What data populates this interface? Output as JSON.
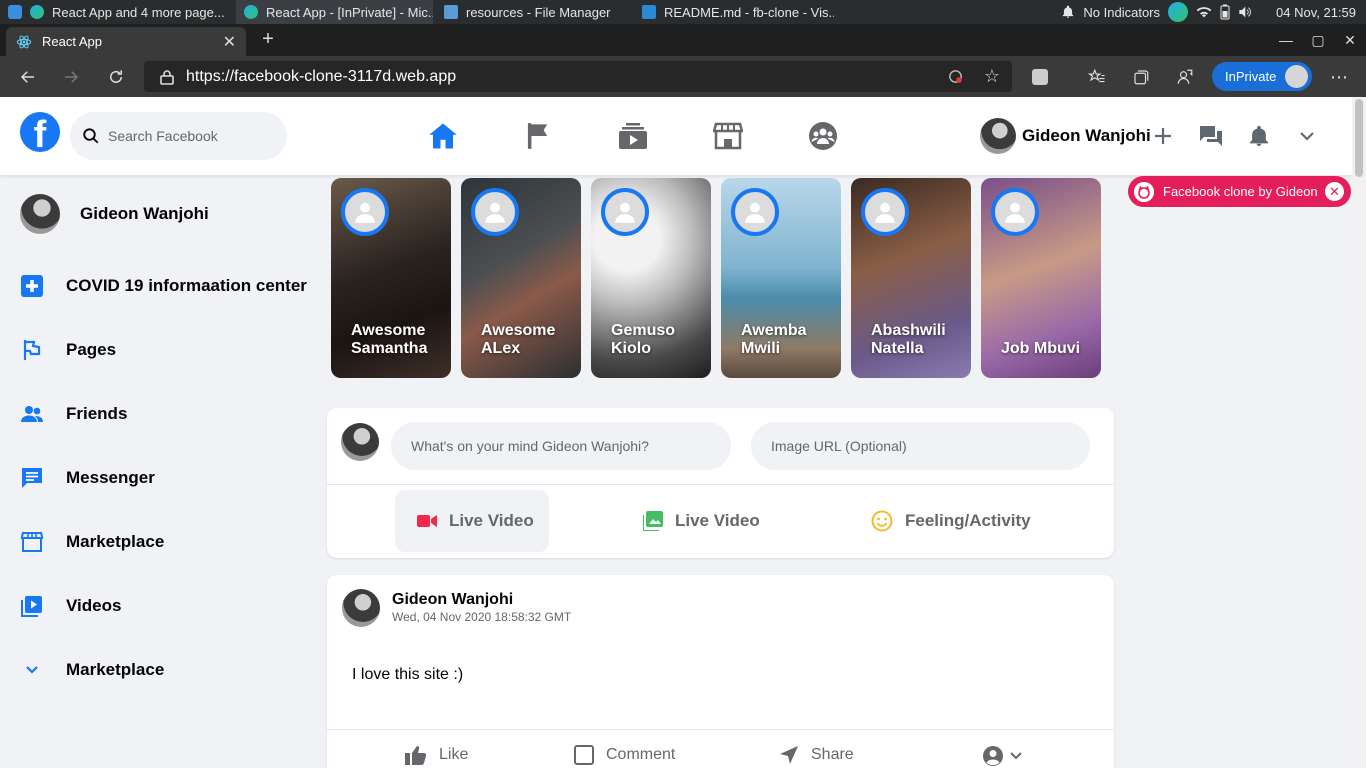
{
  "taskbar": {
    "tasks": [
      {
        "label": "React App and 4 more page..."
      },
      {
        "label": "React App - [InPrivate] - Mic..."
      },
      {
        "label": "resources - File Manager"
      },
      {
        "label": "README.md - fb-clone - Vis..."
      }
    ],
    "indicator_text": "No Indicators",
    "datetime": "04 Nov, 21:59"
  },
  "browser": {
    "tab_title": "React App",
    "url": "https://facebook-clone-3117d.web.app",
    "inprivate_label": "InPrivate"
  },
  "header": {
    "search_placeholder": "Search Facebook",
    "user_name": "Gideon Wanjohi"
  },
  "sidebar": {
    "profile_name": "Gideon Wanjohi",
    "items": [
      {
        "label": "COVID 19 informaation center",
        "icon": "covid-info-icon"
      },
      {
        "label": "Pages",
        "icon": "pages-flag-icon"
      },
      {
        "label": "Friends",
        "icon": "friends-icon"
      },
      {
        "label": "Messenger",
        "icon": "messenger-icon"
      },
      {
        "label": "Marketplace",
        "icon": "marketplace-icon"
      },
      {
        "label": "Videos",
        "icon": "videos-icon"
      },
      {
        "label": "Marketplace",
        "icon": "chevron-down-icon"
      }
    ]
  },
  "stories": [
    {
      "name": "Awesome Samantha"
    },
    {
      "name": "Awesome ALex"
    },
    {
      "name": "Gemuso Kiolo"
    },
    {
      "name": "Awemba Mwili"
    },
    {
      "name": "Abashwili Natella"
    },
    {
      "name": "Job Mbuvi"
    }
  ],
  "composer": {
    "text_placeholder": "What's on your mind Gideon Wanjohi?",
    "image_placeholder": "Image URL (Optional)",
    "actions": [
      {
        "label": "Live Video"
      },
      {
        "label": "Live Video"
      },
      {
        "label": "Feeling/Activity"
      }
    ]
  },
  "post": {
    "author": "Gideon Wanjohi",
    "timestamp": "Wed, 04 Nov 2020 18:58:32 GMT",
    "message": "I love this site :)",
    "actions": [
      {
        "label": "Like"
      },
      {
        "label": "Comment"
      },
      {
        "label": "Share"
      }
    ]
  },
  "toast": {
    "message": "Facebook clone by Gideon"
  },
  "colors": {
    "brand": "#1877f2",
    "toast": "#e41e5b",
    "live_video_red": "#f02849",
    "photo_green": "#45bd62",
    "feeling_yellow": "#f7b928"
  }
}
